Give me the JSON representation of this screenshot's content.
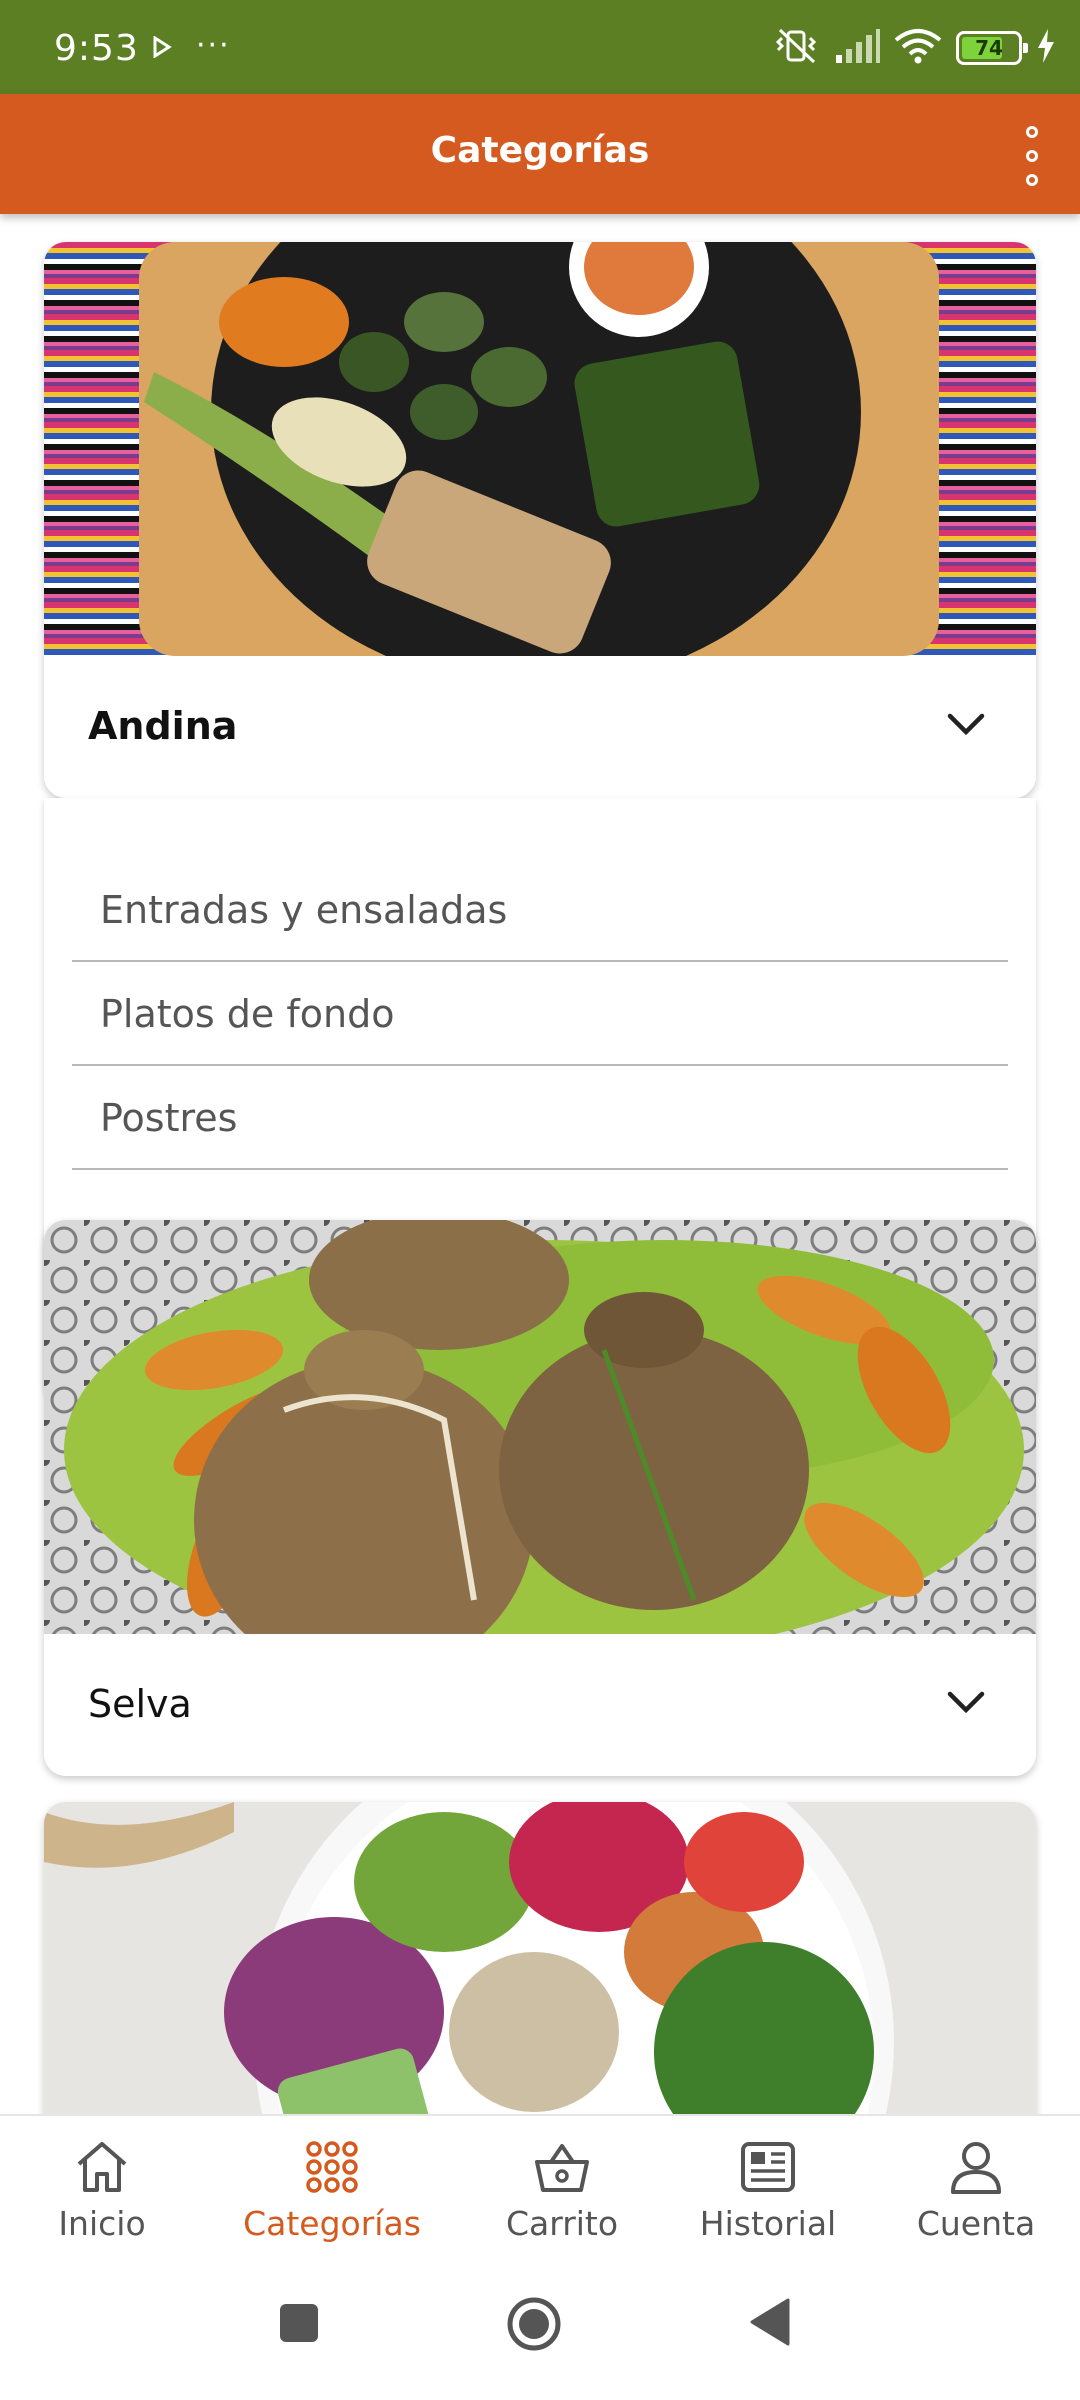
{
  "status_bar": {
    "time": "9:53",
    "more_indicator": "···",
    "battery_level": "74",
    "battery_fraction": 0.74,
    "icons": [
      "play-icon",
      "vibrate-off-icon",
      "signal-icon",
      "wifi-icon",
      "battery-icon",
      "charging-bolt-icon"
    ]
  },
  "app_bar": {
    "title": "Categorías",
    "menu_icon": "overflow-menu-icon"
  },
  "categories": [
    {
      "name": "Andina",
      "expanded": true,
      "subcategories": [
        {
          "label": "Entradas y ensaladas"
        },
        {
          "label": "Platos de fondo"
        },
        {
          "label": "Postres"
        }
      ]
    },
    {
      "name": "Selva",
      "expanded": false
    }
  ],
  "bottom_nav": {
    "items": [
      {
        "label": "Inicio",
        "icon": "home-icon"
      },
      {
        "label": "Categorías",
        "icon": "grid-dots-icon",
        "active": true
      },
      {
        "label": "Carrito",
        "icon": "basket-icon"
      },
      {
        "label": "Historial",
        "icon": "newspaper-icon"
      },
      {
        "label": "Cuenta",
        "icon": "user-icon"
      }
    ]
  },
  "system_nav": {
    "icons": [
      "recents-square-icon",
      "home-circle-icon",
      "back-triangle-icon"
    ]
  },
  "colors": {
    "status_bar": "#5b7f22",
    "app_bar": "#d45a1f",
    "accent": "#d45a1f",
    "inactive": "#555555"
  }
}
